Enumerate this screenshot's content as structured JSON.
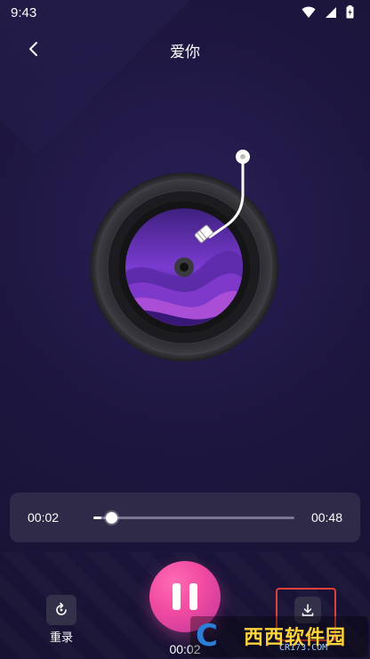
{
  "status_bar": {
    "time": "9:43",
    "icons": [
      "wifi-icon",
      "signal-icon",
      "battery-icon"
    ]
  },
  "header": {
    "back_icon": "chevron-left-icon",
    "title": "爱你"
  },
  "player": {
    "current_time": "00:02",
    "total_time": "00:48",
    "progress_fraction": 0.04
  },
  "controls": {
    "rerecord_label": "重录",
    "rerecord_icon": "refresh-icon",
    "pause_icon": "pause-icon",
    "elapsed_time": "00:02",
    "download_icon": "download-icon"
  },
  "watermark": {
    "logo": "C",
    "brand": "西西软件园",
    "url": "CR173.COM"
  },
  "colors": {
    "accent_pink": "#f04aa0",
    "highlight_red": "#e0413b",
    "card_bg": "#2e2a47"
  }
}
